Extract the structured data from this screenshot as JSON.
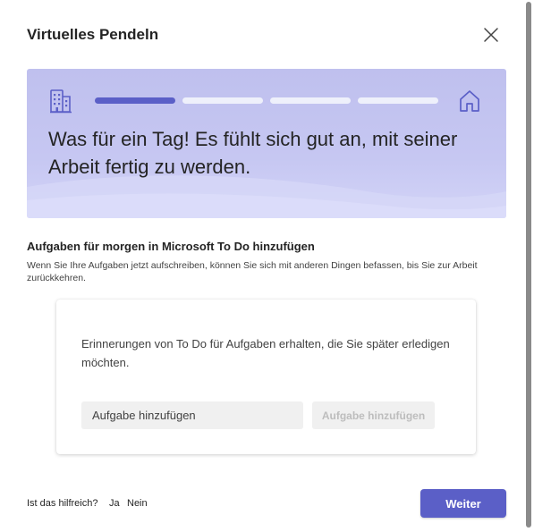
{
  "dialog": {
    "title": "Virtuelles Pendeln",
    "close_icon": "close-icon"
  },
  "banner": {
    "text": "Was für ein Tag! Es fühlt sich gut an, mit seiner Arbeit fertig zu werden.",
    "left_icon": "building-icon",
    "right_icon": "home-icon",
    "progress": {
      "current_step": 1,
      "total_steps": 4
    },
    "colors": {
      "active": "#5b5fc7",
      "inactive": "#eef0fb",
      "icon": "#5b5fc7"
    }
  },
  "section": {
    "title": "Aufgaben für morgen in Microsoft To Do hinzufügen",
    "description": "Wenn Sie Ihre Aufgaben jetzt aufschreiben, können Sie sich mit anderen Dingen befassen, bis Sie zur Arbeit zurückkehren."
  },
  "card": {
    "text": "Erinnerungen von To Do für Aufgaben erhalten, die Sie später erledigen möchten.",
    "input_placeholder": "Aufgabe hinzufügen",
    "add_button_label": "Aufgabe hinzufügen"
  },
  "footer": {
    "question": "Ist das hilfreich?",
    "yes_label": "Ja",
    "no_label": "Nein",
    "next_label": "Weiter",
    "accent": "#5b5fc7"
  }
}
